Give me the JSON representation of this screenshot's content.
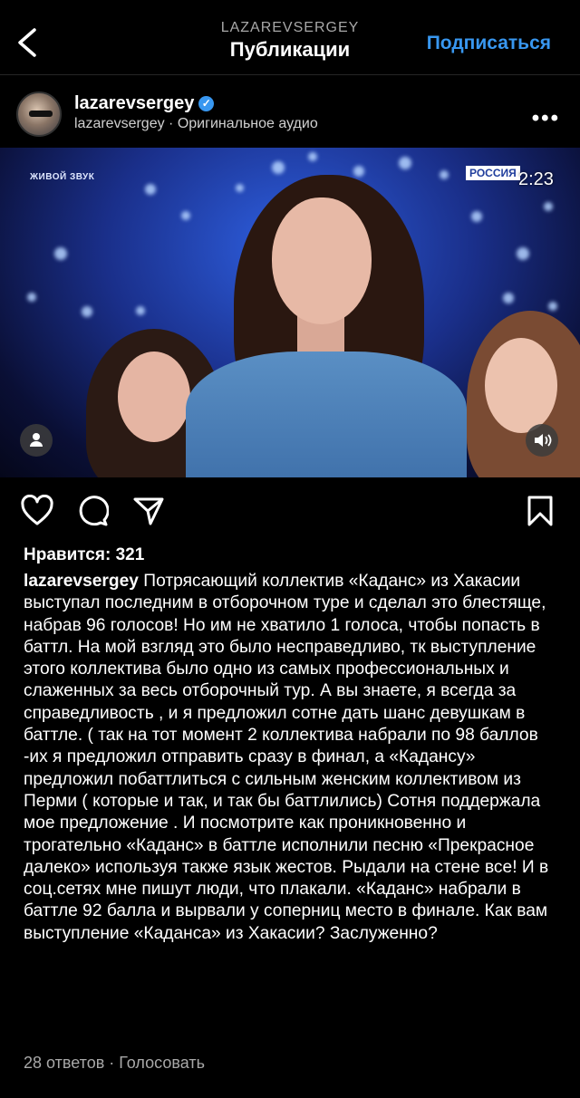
{
  "header": {
    "account": "LAZAREVSERGEY",
    "title": "Публикации",
    "follow_label": "Подписаться"
  },
  "post": {
    "username": "lazarevsergey",
    "subline": "lazarevsergey · Оригинальное аудио",
    "media": {
      "live_label": "ЖИВОЙ ЗВУК",
      "channel_label": "РОССИЯ",
      "timer": "2:23"
    },
    "likes_text": "Нравится: 321",
    "caption_user": "lazarevsergey",
    "caption_text": "Потрясающий коллектив «Каданс» из Хакасии выступал последним в отборочном туре и сделал это  блестяще, набрав 96 голосов! Но им не хватило 1 голоса, чтобы попасть в баттл. На мой взгляд это было несправедливо, тк выступление этого коллектива было одно из самых профессиональных и слаженных за весь отборочный тур. А вы знаете, я всегда за справедливость , и я предложил сотне дать шанс девушкам в баттле. ( так на тот момент 2 коллектива набрали по 98 баллов -их я предложил отправить сразу в финал, а «Кадансу» предложил побаттлиться с сильным женским коллективом из Перми ( которые и так, и так бы баттлились)  Сотня поддержала мое предложение . И посмотрите как проникновенно и трогательно «Каданс»  в баттле исполнили песню «Прекрасное далеко» используя также язык жестов. Рыдали на стене все! И в соц.сетях мне пишут люди, что плакали. «Каданс» набрали в баттле 92 балла и вырвали у соперниц место в финале. Как вам выступление «Каданса» из Хакасии? Заслуженно?",
    "comments_text": "28 ответов · Голосовать"
  },
  "icons": [
    "back-arrow-icon",
    "verified-icon",
    "more-icon",
    "user-tag-icon",
    "sound-icon",
    "heart-icon",
    "comment-icon",
    "share-icon",
    "bookmark-icon"
  ],
  "colors": {
    "accent": "#3897f0",
    "background": "#000000"
  }
}
